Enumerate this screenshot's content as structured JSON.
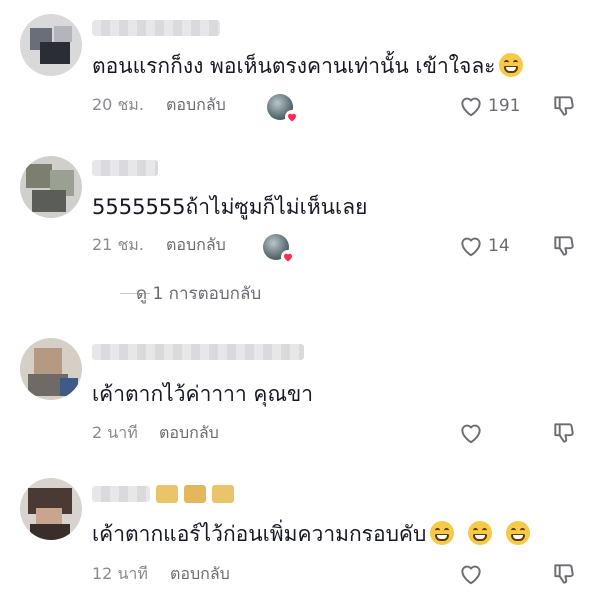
{
  "comments": [
    {
      "text": "ตอนแรกก็งง พอเห็นตรงคานเท่านั้น เข้าใจละ",
      "emoji": [
        "face-with-tears-of-joy-icon"
      ],
      "time": "20 ชม.",
      "reply_label": "ตอบกลับ",
      "creator_liked": true,
      "likes": "191"
    },
    {
      "text": "5555555ถ้าไม่ซูมก็ไม่เห็นเลย",
      "emoji": [],
      "time": "21 ชม.",
      "reply_label": "ตอบกลับ",
      "creator_liked": true,
      "likes": "14"
    },
    {
      "text": "เค้าตากไว้ค่าาาา คุณขา",
      "emoji": [],
      "time": "2 นาที",
      "reply_label": "ตอบกลับ",
      "creator_liked": false,
      "likes": ""
    },
    {
      "text": "เค้าตากแอร์ไว้ก่อนเพิ่มความกรอบคับ",
      "emoji": [
        "grinning-face-icon",
        "grinning-face-icon",
        "grinning-face-icon"
      ],
      "time": "12 นาที",
      "reply_label": "ตอบกลับ",
      "creator_liked": false,
      "likes": ""
    }
  ],
  "view_replies": "ดู 1 การตอบกลับ",
  "colors": {
    "text": "#161823",
    "meta": "#8a8b91",
    "heart_badge": "#fe2c55"
  }
}
